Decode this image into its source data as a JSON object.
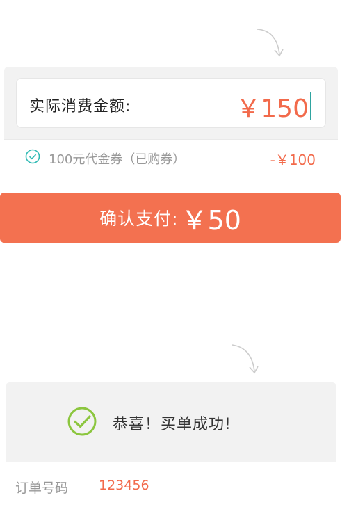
{
  "payment": {
    "amount_label": "实际消费金额:",
    "amount_value": "￥150",
    "coupon_text": "100元代金券（已购券）",
    "coupon_amount": "-￥100"
  },
  "confirm": {
    "label": "确认支付:",
    "price": "￥50"
  },
  "success": {
    "message": "恭喜！买单成功!",
    "order_label": "订单号码",
    "order_number": "123456"
  },
  "colors": {
    "accent": "#f37150",
    "price_text": "#f26a4b",
    "check_teal": "#2fbab4",
    "success_green": "#8cc63f"
  },
  "icons": {
    "top_arrow": "curved-arrow-icon",
    "bottom_arrow": "curved-arrow-icon",
    "coupon_check": "check-circle-icon",
    "success": "success-check-icon"
  }
}
